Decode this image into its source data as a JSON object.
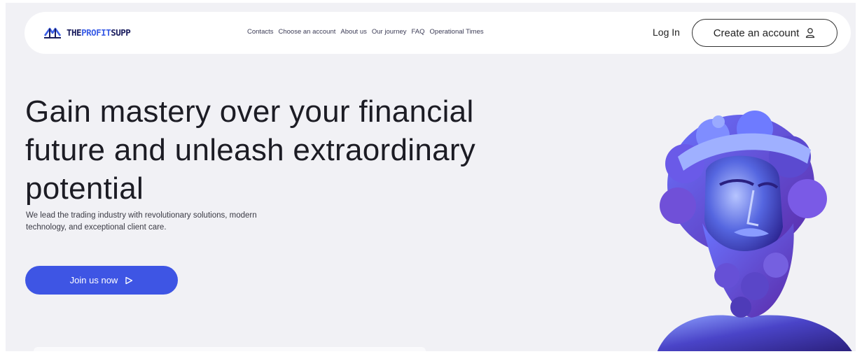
{
  "brand": {
    "name_prefix": "THE",
    "name_highlight": "PROFIT",
    "name_suffix": "SUPP"
  },
  "nav": {
    "links": [
      "Contacts",
      "Choose an account",
      "About us",
      "Our journey",
      "FAQ",
      "Operational Times"
    ],
    "login_label": "Log In",
    "create_account_label": "Create an account"
  },
  "hero": {
    "title": "Gain mastery over your financial future and unleash extraordinary potential",
    "subtitle": "We lead the trading industry with revolutionary solutions, modern technology, and exceptional client care.",
    "cta_label": "Join us now"
  },
  "colors": {
    "accent": "#3e55e4",
    "background": "#f1f1f5",
    "statue_primary": "#4a44c8",
    "statue_highlight": "#8ea2ff"
  },
  "icons": {
    "create_account": "user-icon",
    "cta": "play-triangle-icon"
  }
}
